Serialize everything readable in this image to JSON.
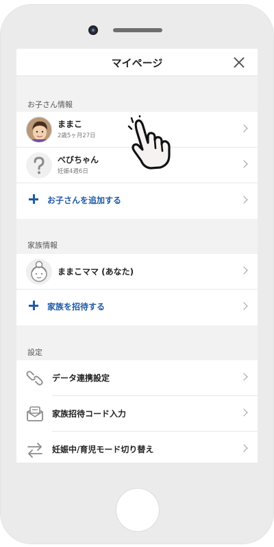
{
  "header": {
    "title": "マイページ"
  },
  "children_section": {
    "label": "お子さん情報",
    "items": [
      {
        "name": "ままこ",
        "sub": "2歳5ヶ月27日"
      },
      {
        "name": "べびちゃん",
        "sub": "妊娠4週6日"
      }
    ],
    "add_label": "お子さんを追加する"
  },
  "family_section": {
    "label": "家族情報",
    "member": {
      "name": "ままこママ (あなた)"
    },
    "invite_label": "家族を招待する"
  },
  "settings_section": {
    "label": "設定",
    "items": [
      {
        "label": "データ連携設定",
        "icon": "link-icon"
      },
      {
        "label": "家族招待コード入力",
        "icon": "envelope-icon"
      },
      {
        "label": "妊娠中/育児モード切り替え",
        "icon": "swap-arrows-icon"
      }
    ]
  },
  "colors": {
    "accent": "#1f5aa6",
    "background": "#f2f2f2"
  }
}
